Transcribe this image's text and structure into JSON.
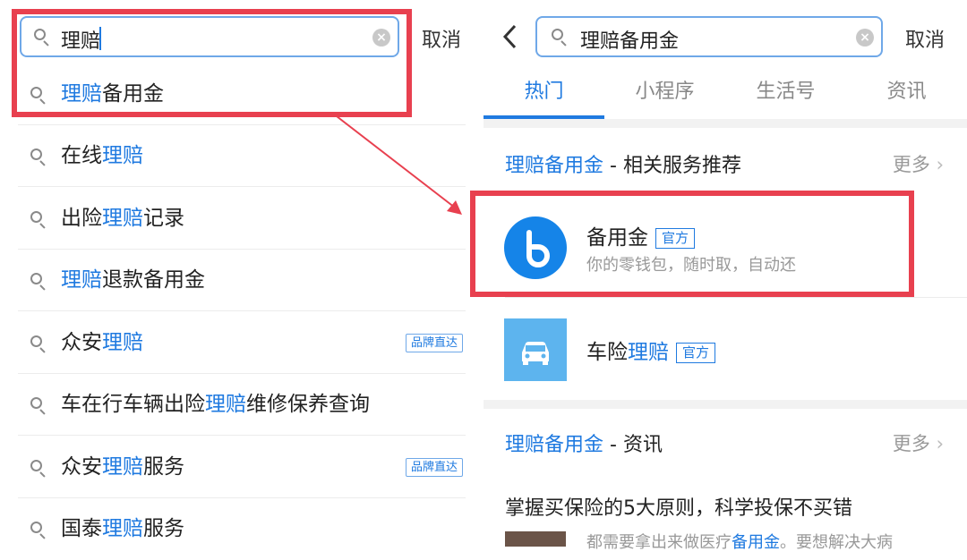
{
  "left": {
    "search": {
      "query": "理赔",
      "cancel_label": "取消"
    },
    "suggestions": [
      {
        "plain_before": "",
        "highlight": "理赔",
        "plain_after": "备用金",
        "badge": ""
      },
      {
        "plain_before": "在线",
        "highlight": "理赔",
        "plain_after": "",
        "badge": ""
      },
      {
        "plain_before": "出险",
        "highlight": "理赔",
        "plain_after": "记录",
        "badge": ""
      },
      {
        "plain_before": "",
        "highlight": "理赔",
        "plain_after": "退款备用金",
        "badge": ""
      },
      {
        "plain_before": "众安",
        "highlight": "理赔",
        "plain_after": "",
        "badge": "品牌直达"
      },
      {
        "plain_before": "车在行车辆出险",
        "highlight": "理赔",
        "plain_after": "维修保养查询",
        "badge": ""
      },
      {
        "plain_before": "众安",
        "highlight": "理赔",
        "plain_after": "服务",
        "badge": "品牌直达"
      },
      {
        "plain_before": "国泰",
        "highlight": "理赔",
        "plain_after": "服务",
        "badge": ""
      }
    ]
  },
  "right": {
    "search": {
      "query": "理赔备用金",
      "cancel_label": "取消"
    },
    "tabs": [
      "热门",
      "小程序",
      "生活号",
      "资讯"
    ],
    "section1": {
      "title_highlight": "理赔备用金",
      "title_rest": " - 相关服务推荐",
      "more": "更多"
    },
    "services": [
      {
        "name_plain": "备用金",
        "name_highlight": "",
        "name_after": "",
        "tag": "官方",
        "desc": "你的零钱包，随时取，自动还",
        "icon": "b-logo-icon"
      },
      {
        "name_plain": "车险",
        "name_highlight": "理赔",
        "name_after": "",
        "tag": "官方",
        "desc": "",
        "icon": "car-icon"
      }
    ],
    "section2": {
      "title_highlight": "理赔备用金",
      "title_rest": " - 资讯",
      "more": "更多"
    },
    "article": {
      "title": "掌握买保险的5大原则，科学投保不买错",
      "snippet_before": "都需要拿出来做医疗",
      "snippet_highlight": "备用金",
      "snippet_after": "。要想解决大病"
    }
  },
  "colors": {
    "accent": "#1f7ae0",
    "annotation_red": "#e8404f"
  }
}
